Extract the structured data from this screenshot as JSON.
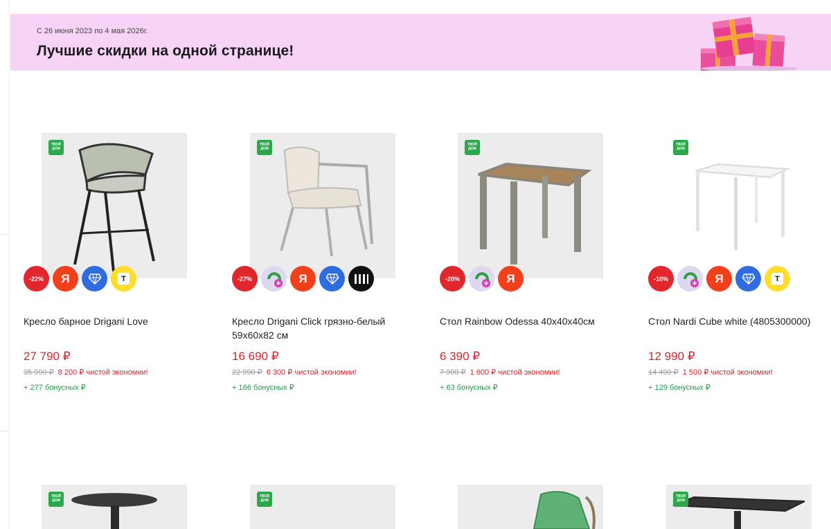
{
  "banner": {
    "dates": "С 26 июня 2023 по 4 мая 2026г.",
    "title": "Лучшие скидки на одной странице!"
  },
  "badge_brand": [
    "ТВОЙ",
    "ДОМ"
  ],
  "products": [
    {
      "name": "Кресло барное Drigani Love",
      "price": "27 790 ₽",
      "old_price": "35 990 ₽",
      "savings": "8 200 ₽ чистой экономии!",
      "bonus": "+ 277 бонусных ₽",
      "discount": "-22%",
      "badges": [
        "discount",
        "yandex",
        "diamond",
        "t-bank"
      ]
    },
    {
      "name": "Кресло Drigani Click грязно-белый 59x60x82 см",
      "price": "16 690 ₽",
      "old_price": "22 990 ₽",
      "savings": "6 300 ₽ чистой экономии!",
      "bonus": "+ 166 бонусных ₽",
      "discount": "-27%",
      "badges": [
        "discount",
        "magnit-plus",
        "yandex",
        "diamond",
        "bars"
      ]
    },
    {
      "name": "Стол Rainbow Odessa 40x40x40см",
      "price": "6 390 ₽",
      "old_price": "7 990 ₽",
      "savings": "1 600 ₽ чистой экономии!",
      "bonus": "+ 63 бонусных ₽",
      "discount": "-20%",
      "badges": [
        "discount",
        "magnit-plus",
        "yandex"
      ]
    },
    {
      "name": "Стол Nardi Cube white (4805300000)",
      "price": "12 990 ₽",
      "old_price": "14 490 ₽",
      "savings": "1 500 ₽ чистой экономии!",
      "bonus": "+ 129 бонусных ₽",
      "discount": "-10%",
      "badges": [
        "discount",
        "magnit-plus",
        "yandex",
        "diamond",
        "t-bank"
      ]
    }
  ],
  "icons": {
    "yandex": "Я",
    "t-bank": "T"
  }
}
